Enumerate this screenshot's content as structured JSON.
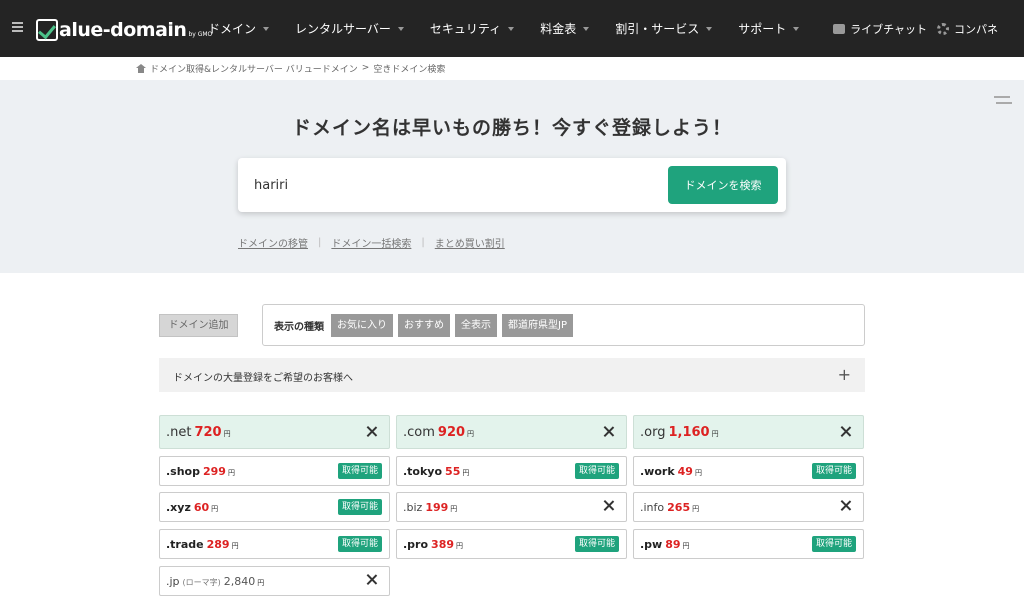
{
  "header": {
    "logo_text": "alue-domain",
    "logo_sub": "by GMO",
    "nav": [
      {
        "label": "ドメイン"
      },
      {
        "label": "レンタルサーバー"
      },
      {
        "label": "セキュリティ"
      },
      {
        "label": "料金表"
      },
      {
        "label": "割引・サービス"
      },
      {
        "label": "サポート"
      }
    ],
    "right": {
      "chat": "ライブチャット",
      "panel": "コンパネ"
    }
  },
  "breadcrumb": {
    "home": "ドメイン取得&レンタルサーバー バリュードメイン",
    "sep": ">",
    "current": "空きドメイン検索"
  },
  "hero": {
    "title": "ドメイン名は早いもの勝ち！今すぐ登録しよう！",
    "search_value": "hariri",
    "search_button": "ドメインを検索",
    "links": [
      "ドメインの移管",
      "ドメイン一括検索",
      "まとめ買い割引"
    ]
  },
  "filter": {
    "add_button": "ドメイン追加",
    "label": "表示の種類",
    "chips": [
      "お気に入り",
      "おすすめ",
      "全表示",
      "都道府県型JP"
    ]
  },
  "bulk": {
    "text": "ドメインの大量登録をご希望のお客様へ",
    "plus": "+"
  },
  "badge_text": "取得可能",
  "yen": "円",
  "domains": {
    "net": {
      "name": ".net",
      "price": "720"
    },
    "com": {
      "name": ".com",
      "price": "920"
    },
    "org": {
      "name": ".org",
      "price": "1,160"
    },
    "shop": {
      "name": ".shop",
      "price": "299"
    },
    "tokyo": {
      "name": ".tokyo",
      "price": "55"
    },
    "work": {
      "name": ".work",
      "price": "49"
    },
    "xyz": {
      "name": ".xyz",
      "price": "60"
    },
    "biz": {
      "name": ".biz",
      "price": "199"
    },
    "info": {
      "name": ".info",
      "price": "265"
    },
    "trade": {
      "name": ".trade",
      "price": "289"
    },
    "pro": {
      "name": ".pro",
      "price": "389"
    },
    "pw": {
      "name": ".pw",
      "price": "89"
    },
    "jp": {
      "name": ".jp",
      "note": "(ローマ字)",
      "price": "2,840"
    }
  },
  "colors": {
    "accent": "#1fa37d",
    "price": "#dd2222",
    "header_bg": "#242424",
    "hero_bg": "#edf0f3"
  }
}
